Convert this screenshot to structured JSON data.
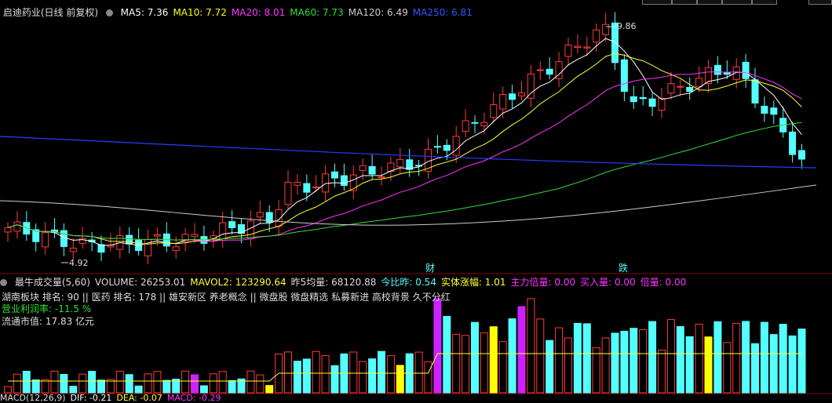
{
  "header": {
    "title": "启迪药业(日线 前复权)",
    "ma_indicators": [
      {
        "label": "MA5: 7.36",
        "color": "#ffffff"
      },
      {
        "label": "MA10: 7.72",
        "color": "#ffff00"
      },
      {
        "label": "MA20: 8.01",
        "color": "#ff33ff"
      },
      {
        "label": "MA60: 7.73",
        "color": "#33dd33"
      },
      {
        "label": "MA120: 6.49",
        "color": "#cccccc"
      },
      {
        "label": "MA250: 6.81",
        "color": "#3355ff"
      }
    ]
  },
  "price_chart": {
    "high_label": "9.86",
    "low_label": "4.92",
    "markers": [
      "财",
      "跌"
    ],
    "colors": {
      "up": "#ff3a3a",
      "down": "#54ffff",
      "ma5": "#ffffff",
      "ma10": "#ffff33",
      "ma20": "#ff33ff",
      "ma60": "#33dd33",
      "ma120": "#cccccc",
      "ma250": "#2a3cff"
    }
  },
  "volume_panel": {
    "items": [
      {
        "label": "最牛成交量(5,60)",
        "color": "#dddddd"
      },
      {
        "label": "VOLUME: 26253.01",
        "color": "#dddddd"
      },
      {
        "label": "MAVOL2: 123290.64",
        "color": "#ffff33"
      },
      {
        "label": "昨5均量: 68120.88",
        "color": "#dddddd"
      },
      {
        "label": "今比昨: 0.54",
        "color": "#54ffff"
      },
      {
        "label": "实体涨幅: 1.01",
        "color": "#ffff33"
      },
      {
        "label": "主力倍量: 0.00",
        "color": "#ff33ff"
      },
      {
        "label": "买入量: 0.00",
        "color": "#ff33ff"
      },
      {
        "label": "倍量: 0.00",
        "color": "#ff33ff"
      }
    ],
    "sector_line": "湖南板块  排名: 90 || 医药  排名: 178 || 雄安新区 养老概念  || 微盘股 微盘精选 私募新进 高校背景 久不分红",
    "profit_line": "营业利润率: -11.5 %",
    "mcap_line": "流通市值: 17.83 亿元"
  },
  "macd_header": {
    "items": [
      {
        "label": "MACD(12,26,9)",
        "color": "#dddddd"
      },
      {
        "label": "DIF: -0.21",
        "color": "#ffffff"
      },
      {
        "label": "DEA: -0.07",
        "color": "#ffff33"
      },
      {
        "label": "MACD: -0.29",
        "color": "#ff33ff"
      }
    ]
  }
}
